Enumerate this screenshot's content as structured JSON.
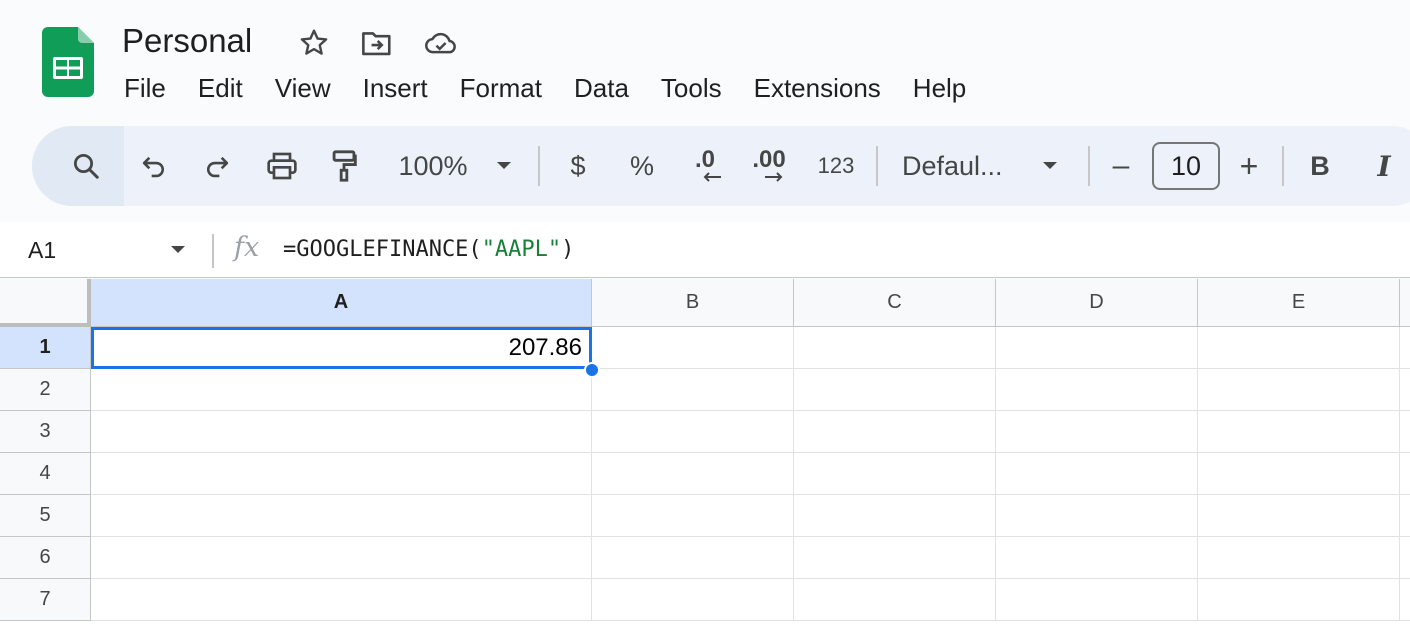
{
  "document": {
    "title": "Personal"
  },
  "menu": [
    "File",
    "Edit",
    "View",
    "Insert",
    "Format",
    "Data",
    "Tools",
    "Extensions",
    "Help"
  ],
  "toolbar": {
    "zoom": "100%",
    "currency_label": "$",
    "percent_label": "%",
    "decrease_decimals_label": ".0",
    "increase_decimals_label": ".00",
    "number_format_label": "123",
    "font_name": "Defaul...",
    "font_size": "10",
    "decrease_font_label": "–",
    "increase_font_label": "+",
    "bold_label": "B",
    "italic_label": "I"
  },
  "formula_bar": {
    "name_box": "A1",
    "fx_label": "fx",
    "formula_prefix": "=GOOGLEFINANCE(",
    "formula_arg": "\"AAPL\"",
    "formula_suffix": ")"
  },
  "grid": {
    "columns": [
      "A",
      "B",
      "C",
      "D",
      "E"
    ],
    "rows": [
      "1",
      "2",
      "3",
      "4",
      "5",
      "6",
      "7"
    ],
    "selected_cell": "A1",
    "cell_a1_value": "207.86"
  },
  "colors": {
    "accent": "#1a73e8",
    "selected_header": "#d3e3fd",
    "sheets_green": "#0f9d58",
    "formula_string": "#188038"
  }
}
